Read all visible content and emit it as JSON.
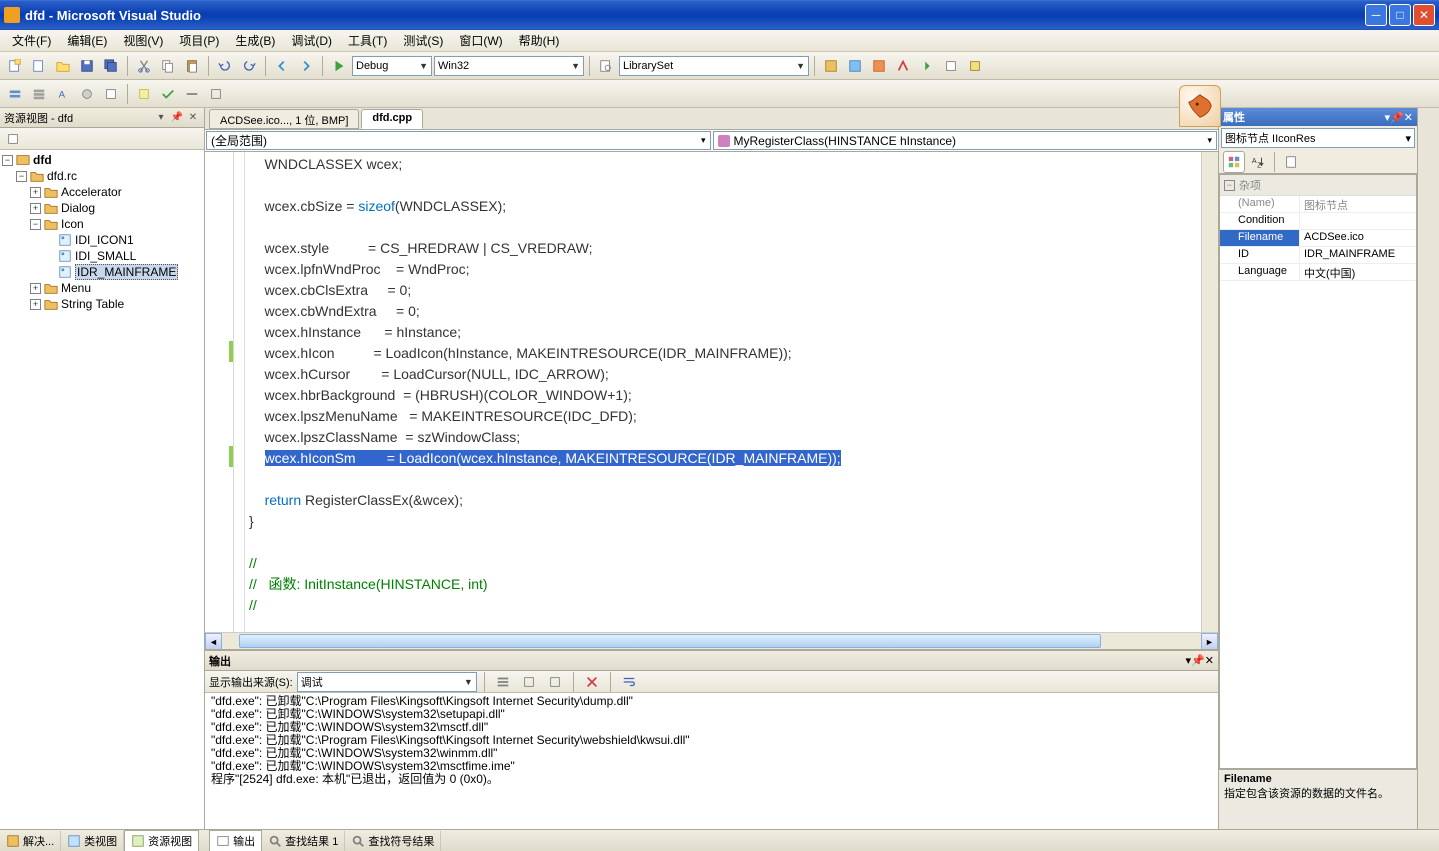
{
  "window": {
    "title": "dfd - Microsoft Visual Studio"
  },
  "menu": {
    "file": "文件(F)",
    "edit": "编辑(E)",
    "view": "视图(V)",
    "project": "项目(P)",
    "build": "生成(B)",
    "debug": "调试(D)",
    "tools": "工具(T)",
    "test": "测试(S)",
    "window": "窗口(W)",
    "help": "帮助(H)"
  },
  "toolbar": {
    "config": "Debug",
    "platform": "Win32",
    "find": "LibrarySet"
  },
  "tree": {
    "title": "资源视图 - dfd",
    "root": "dfd",
    "rc_file": "dfd.rc",
    "folders": {
      "accelerator": "Accelerator",
      "dialog": "Dialog",
      "icon": "Icon",
      "menu": "Menu",
      "string_table": "String Table"
    },
    "icons": {
      "i1": "IDI_ICON1",
      "i2": "IDI_SMALL",
      "i3": "IDR_MAINFRAME"
    }
  },
  "editor": {
    "tab1": "ACDSee.ico..., 1 位, BMP]",
    "tab2": "dfd.cpp",
    "scope": "(全局范围)",
    "func": "MyRegisterClass(HINSTANCE hInstance)"
  },
  "code": {
    "l1": "    WNDCLASSEX wcex;",
    "l2": "",
    "l3a": "    wcex.cbSize = ",
    "l3b": "sizeof",
    "l3c": "(WNDCLASSEX);",
    "l4": "",
    "l5": "    wcex.style          = CS_HREDRAW | CS_VREDRAW;",
    "l6": "    wcex.lpfnWndProc    = WndProc;",
    "l7": "    wcex.cbClsExtra     = 0;",
    "l8": "    wcex.cbWndExtra     = 0;",
    "l9": "    wcex.hInstance      = hInstance;",
    "l10": "    wcex.hIcon          = LoadIcon(hInstance, MAKEINTRESOURCE(IDR_MAINFRAME));",
    "l11": "    wcex.hCursor        = LoadCursor(NULL, IDC_ARROW);",
    "l12": "    wcex.hbrBackground  = (HBRUSH)(COLOR_WINDOW+1);",
    "l13": "    wcex.lpszMenuName   = MAKEINTRESOURCE(IDC_DFD);",
    "l14": "    wcex.lpszClassName  = szWindowClass;",
    "l15": "wcex.hIconSm        = LoadIcon(wcex.hInstance, MAKEINTRESOURCE(IDR_MAINFRAME));",
    "l16": "",
    "l17a": "    ",
    "l17b": "return",
    "l17c": " RegisterClassEx(&wcex);",
    "l18": "}",
    "l19": "",
    "l20": "//",
    "l21": "//   函数: InitInstance(HINSTANCE, int)",
    "l22": "//"
  },
  "output": {
    "title": "输出",
    "source_label": "显示输出来源(S):",
    "source": "调试",
    "lines": {
      "l1": "\"dfd.exe\": 已卸载\"C:\\Program Files\\Kingsoft\\Kingsoft Internet Security\\dump.dll\"",
      "l2": "\"dfd.exe\": 已卸载\"C:\\WINDOWS\\system32\\setupapi.dll\"",
      "l3": "\"dfd.exe\": 已加载\"C:\\WINDOWS\\system32\\msctf.dll\"",
      "l4": "\"dfd.exe\": 已加载\"C:\\Program Files\\Kingsoft\\Kingsoft Internet Security\\webshield\\kwsui.dll\"",
      "l5": "\"dfd.exe\": 已加载\"C:\\WINDOWS\\system32\\winmm.dll\"",
      "l6": "\"dfd.exe\": 已加载\"C:\\WINDOWS\\system32\\msctfime.ime\"",
      "l7": "程序\"[2524] dfd.exe: 本机\"已退出，返回值为 0 (0x0)。"
    }
  },
  "props": {
    "title": "属性",
    "object": "图标节点 IIconRes",
    "cat_misc": "杂项",
    "name_label": "(Name)",
    "name_val": "图标节点",
    "cond_label": "Condition",
    "cond_val": "",
    "file_label": "Filename",
    "file_val": "ACDSee.ico",
    "id_label": "ID",
    "id_val": "IDR_MAINFRAME",
    "lang_label": "Language",
    "lang_val": "中文(中国)",
    "desc_title": "Filename",
    "desc_text": "指定包含该资源的数据的文件名。"
  },
  "bottom_tabs_left": {
    "solution": "解决...",
    "class": "类视图",
    "resource": "资源视图"
  },
  "bottom_tabs_right": {
    "output": "输出",
    "find1": "查找结果 1",
    "findsym": "查找符号结果"
  }
}
